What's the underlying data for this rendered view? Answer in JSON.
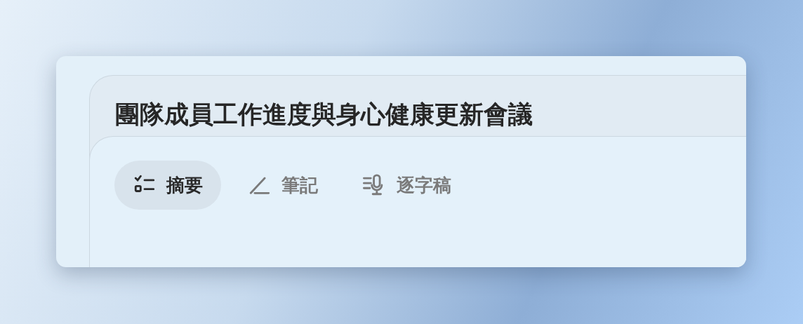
{
  "title": "團隊成員工作進度與身心健康更新會議",
  "tabs": [
    {
      "label": "摘要",
      "kind": "checklist",
      "selected": true
    },
    {
      "label": "筆記",
      "kind": "pen",
      "selected": false
    },
    {
      "label": "逐字稿",
      "kind": "transcript",
      "selected": false
    }
  ]
}
